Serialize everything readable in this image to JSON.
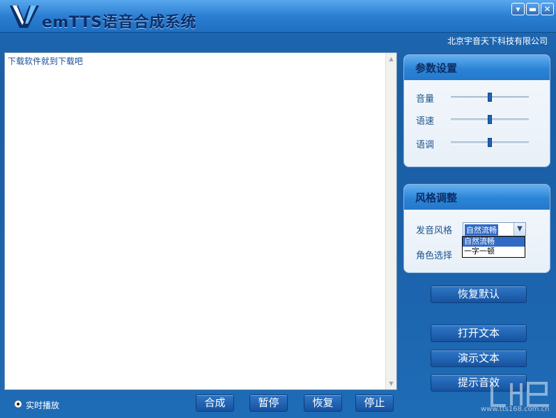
{
  "window": {
    "title": "emTTS语音合成系统",
    "company": "北京宇音天下科技有限公司",
    "controls": [
      "help",
      "minimize",
      "close"
    ]
  },
  "editor": {
    "text": "下载软件就到下载吧"
  },
  "params_panel": {
    "title": "参数设置",
    "sliders": [
      {
        "label": "音量",
        "level": 0.5
      },
      {
        "label": "语速",
        "level": 0.5
      },
      {
        "label": "语调",
        "level": 0.5
      }
    ]
  },
  "style_panel": {
    "title": "风格调整",
    "voice_style_label": "发音风格",
    "voice_style_value": "自然流畅",
    "voice_style_options": [
      "自然流畅",
      "一字一顿"
    ],
    "role_label": "角色选择"
  },
  "side_buttons": {
    "restore_default": "恢复默认",
    "open_text": "打开文本",
    "demo_text": "演示文本",
    "prompt_sound": "提示音效"
  },
  "bottom": {
    "realtime_label": "实时播放",
    "realtime_checked": true,
    "synthesize": "合成",
    "pause": "暂停",
    "resume": "恢复",
    "stop": "停止"
  },
  "watermark": {
    "url": "www.tts168.com.cn"
  },
  "icons": [
    "logo-icon",
    "help-icon",
    "minimize-icon",
    "close-icon",
    "scroll-up-icon",
    "scroll-down-icon",
    "dropdown-arrow-icon"
  ]
}
